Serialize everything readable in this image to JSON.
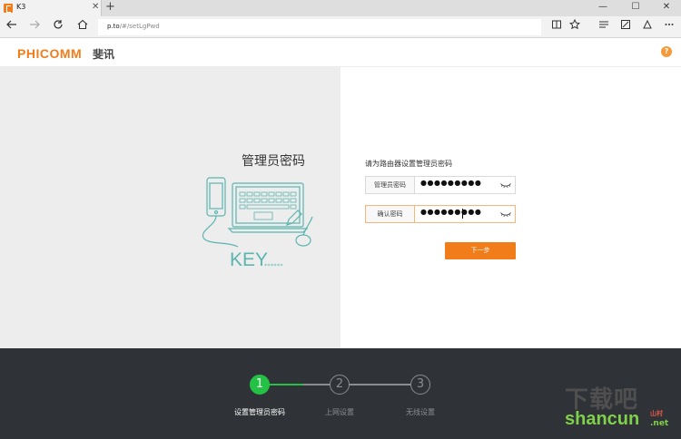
{
  "browser": {
    "tab_title": "K3",
    "tab_close": "✕",
    "new_tab": "+",
    "window_controls": [
      "—",
      "☐",
      "✕"
    ],
    "address_host": "p.to",
    "address_path": "/#/setLgPwd",
    "nav_icons": [
      "back-icon",
      "forward-icon",
      "refresh-icon",
      "home-icon"
    ],
    "toolbar_icons": [
      "reading-view-icon",
      "favorite-star-icon",
      "hub-icon",
      "web-note-icon",
      "share-icon",
      "more-icon"
    ]
  },
  "header": {
    "logo": "PHICOMM",
    "logo_cn": "斐讯",
    "help": "?"
  },
  "main": {
    "title": "管理员密码",
    "illustration_text": "KEY",
    "illustration_stars": "******",
    "prompt": "请为路由器设置管理员密码",
    "fields": [
      {
        "label": "管理员密码",
        "value": "●●●●●●●●●"
      },
      {
        "label": "确认密码",
        "value": "●●●●●●●●●"
      }
    ],
    "next_button": "下一步"
  },
  "steps": [
    {
      "number": "1",
      "label": "设置管理员密码",
      "active": true
    },
    {
      "number": "2",
      "label": "上网设置",
      "active": false
    },
    {
      "number": "3",
      "label": "无线设置",
      "active": false
    }
  ],
  "watermark": {
    "line1": "下载吧",
    "line2": "shancun",
    "line3": ".net",
    "line3_cn": "山村"
  },
  "colors": {
    "accent": "#f07d1a",
    "step_active": "#23c244",
    "footer_bg": "#2f3236",
    "illustration": "#5bb5b0"
  }
}
